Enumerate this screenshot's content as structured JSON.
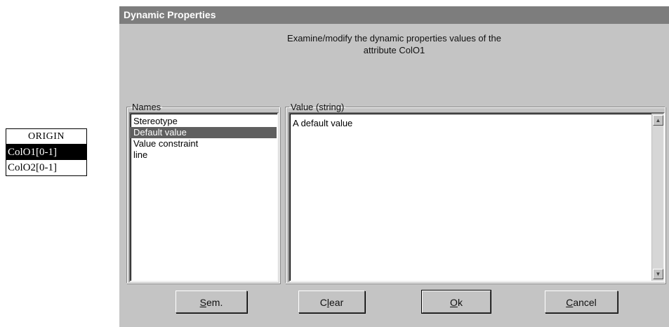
{
  "class_box": {
    "title": "ORIGIN",
    "rows": [
      {
        "label": "ColO1[0-1]",
        "selected": true
      },
      {
        "label": "ColO2[0-1]",
        "selected": false
      }
    ]
  },
  "dialog": {
    "title": "Dynamic Properties",
    "description_line1": "Examine/modify the dynamic properties values of the",
    "description_line2": "attribute ColO1",
    "names": {
      "legend": "Names",
      "items": [
        "Stereotype",
        "Default value",
        "Value constraint",
        "line"
      ],
      "selected_index": 1
    },
    "value": {
      "legend": "Value (string)",
      "text": "A default value"
    },
    "buttons": {
      "sem": {
        "key": "S",
        "rest": "em."
      },
      "clear": {
        "pre": "C",
        "key": "l",
        "rest": "ear"
      },
      "ok": {
        "key": "O",
        "rest": "k"
      },
      "cancel": {
        "key": "C",
        "rest": "ancel"
      }
    }
  },
  "colors": {
    "titlebar": "#7d7d7d",
    "dialog_bg": "#c4c4c4",
    "selection": "#5f5f5f"
  }
}
